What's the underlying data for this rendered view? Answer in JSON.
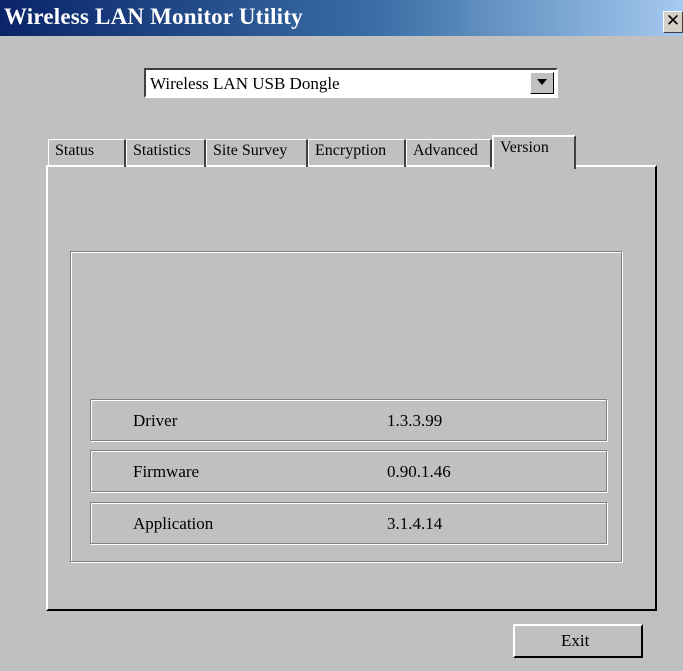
{
  "window": {
    "title": "Wireless LAN Monitor Utility",
    "close_glyph": "✕",
    "icons": [
      "close-icon",
      "dropdown-arrow-icon"
    ],
    "colors": {
      "face": "#c0c0c0",
      "title_start": "#0a246a",
      "title_end": "#a6caf0"
    }
  },
  "device_select": {
    "selected": "Wireless LAN USB Dongle"
  },
  "tabs": [
    {
      "label": "Status"
    },
    {
      "label": "Statistics"
    },
    {
      "label": "Site Survey"
    },
    {
      "label": "Encryption"
    },
    {
      "label": "Advanced"
    },
    {
      "label": "Version",
      "active": true
    }
  ],
  "version_info": [
    {
      "label": "Driver",
      "value": "1.3.3.99"
    },
    {
      "label": "Firmware",
      "value": "0.90.1.46"
    },
    {
      "label": "Application",
      "value": "3.1.4.14"
    }
  ],
  "buttons": {
    "exit_label": "Exit"
  }
}
